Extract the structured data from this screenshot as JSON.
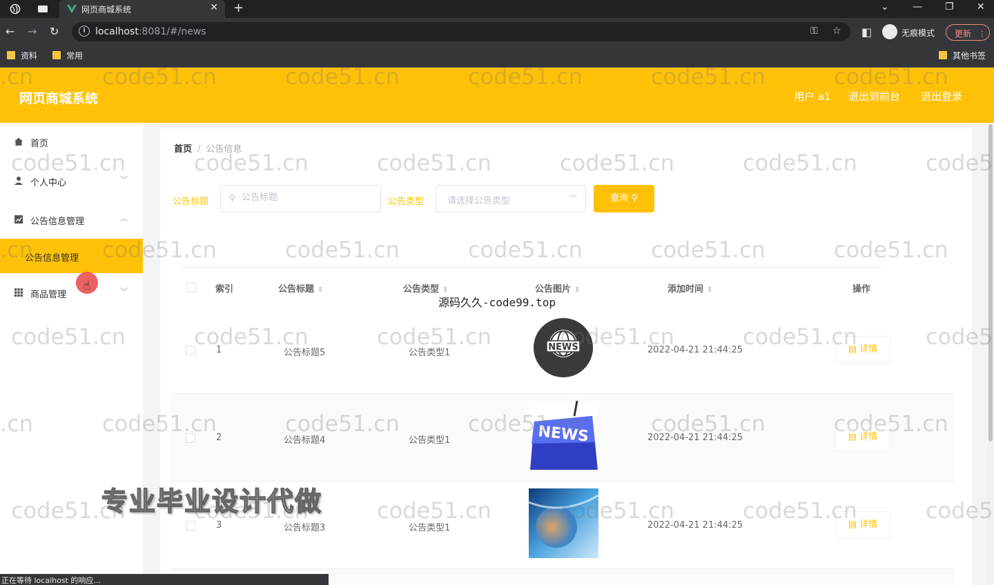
{
  "browser": {
    "tab_title": "网页商城系统",
    "url_host": "localhost",
    "url_rest": ":8081/#/news",
    "incognito_label": "无痕模式",
    "update_label": "更新",
    "bookmarks": [
      "资料",
      "常用"
    ],
    "other_bookmarks": "其他书签",
    "status": "正在等待 localhost 的响应..."
  },
  "header": {
    "title": "网页商城系统",
    "user": "用户 a1",
    "back_front": "退出到前台",
    "logout": "退出登录",
    "accent": "#ffc107"
  },
  "sidebar": {
    "home": "首页",
    "personal": "个人中心",
    "notice_mgmt": "公告信息管理",
    "notice_sub": "公告信息管理",
    "goods_mgmt": "商品管理"
  },
  "breadcrumb": {
    "home": "首页",
    "separator": "/",
    "current": "公告信息"
  },
  "filters": {
    "title_label": "公告标题",
    "title_placeholder": "公告标题",
    "type_label": "公告类型",
    "type_placeholder": "请选择公告类型",
    "query_label": "查询"
  },
  "table": {
    "headers": {
      "index": "索引",
      "title": "公告标题",
      "type": "公告类型",
      "image": "公告图片",
      "time": "添加时间",
      "action": "操作"
    },
    "rows": [
      {
        "index": "1",
        "title": "公告标题5",
        "type": "公告类型1",
        "time": "2022-04-21 21:44:25",
        "action": "详情",
        "image": "globe-news-icon"
      },
      {
        "index": "2",
        "title": "公告标题4",
        "type": "公告类型1",
        "time": "2022-04-21 21:44:25",
        "action": "详情",
        "image": "news-key-icon"
      },
      {
        "index": "3",
        "title": "公告标题3",
        "type": "公告类型1",
        "time": "2022-04-21 21:44:25",
        "action": "详情",
        "image": "news-globe-photo"
      }
    ]
  },
  "overlays": {
    "watermark": "code51.cn",
    "watermark_left_partial": ".cn",
    "watermark_right_partial": "code5",
    "source_caption": "源码久久-code99.top",
    "promo": "专业毕业设计代做"
  }
}
